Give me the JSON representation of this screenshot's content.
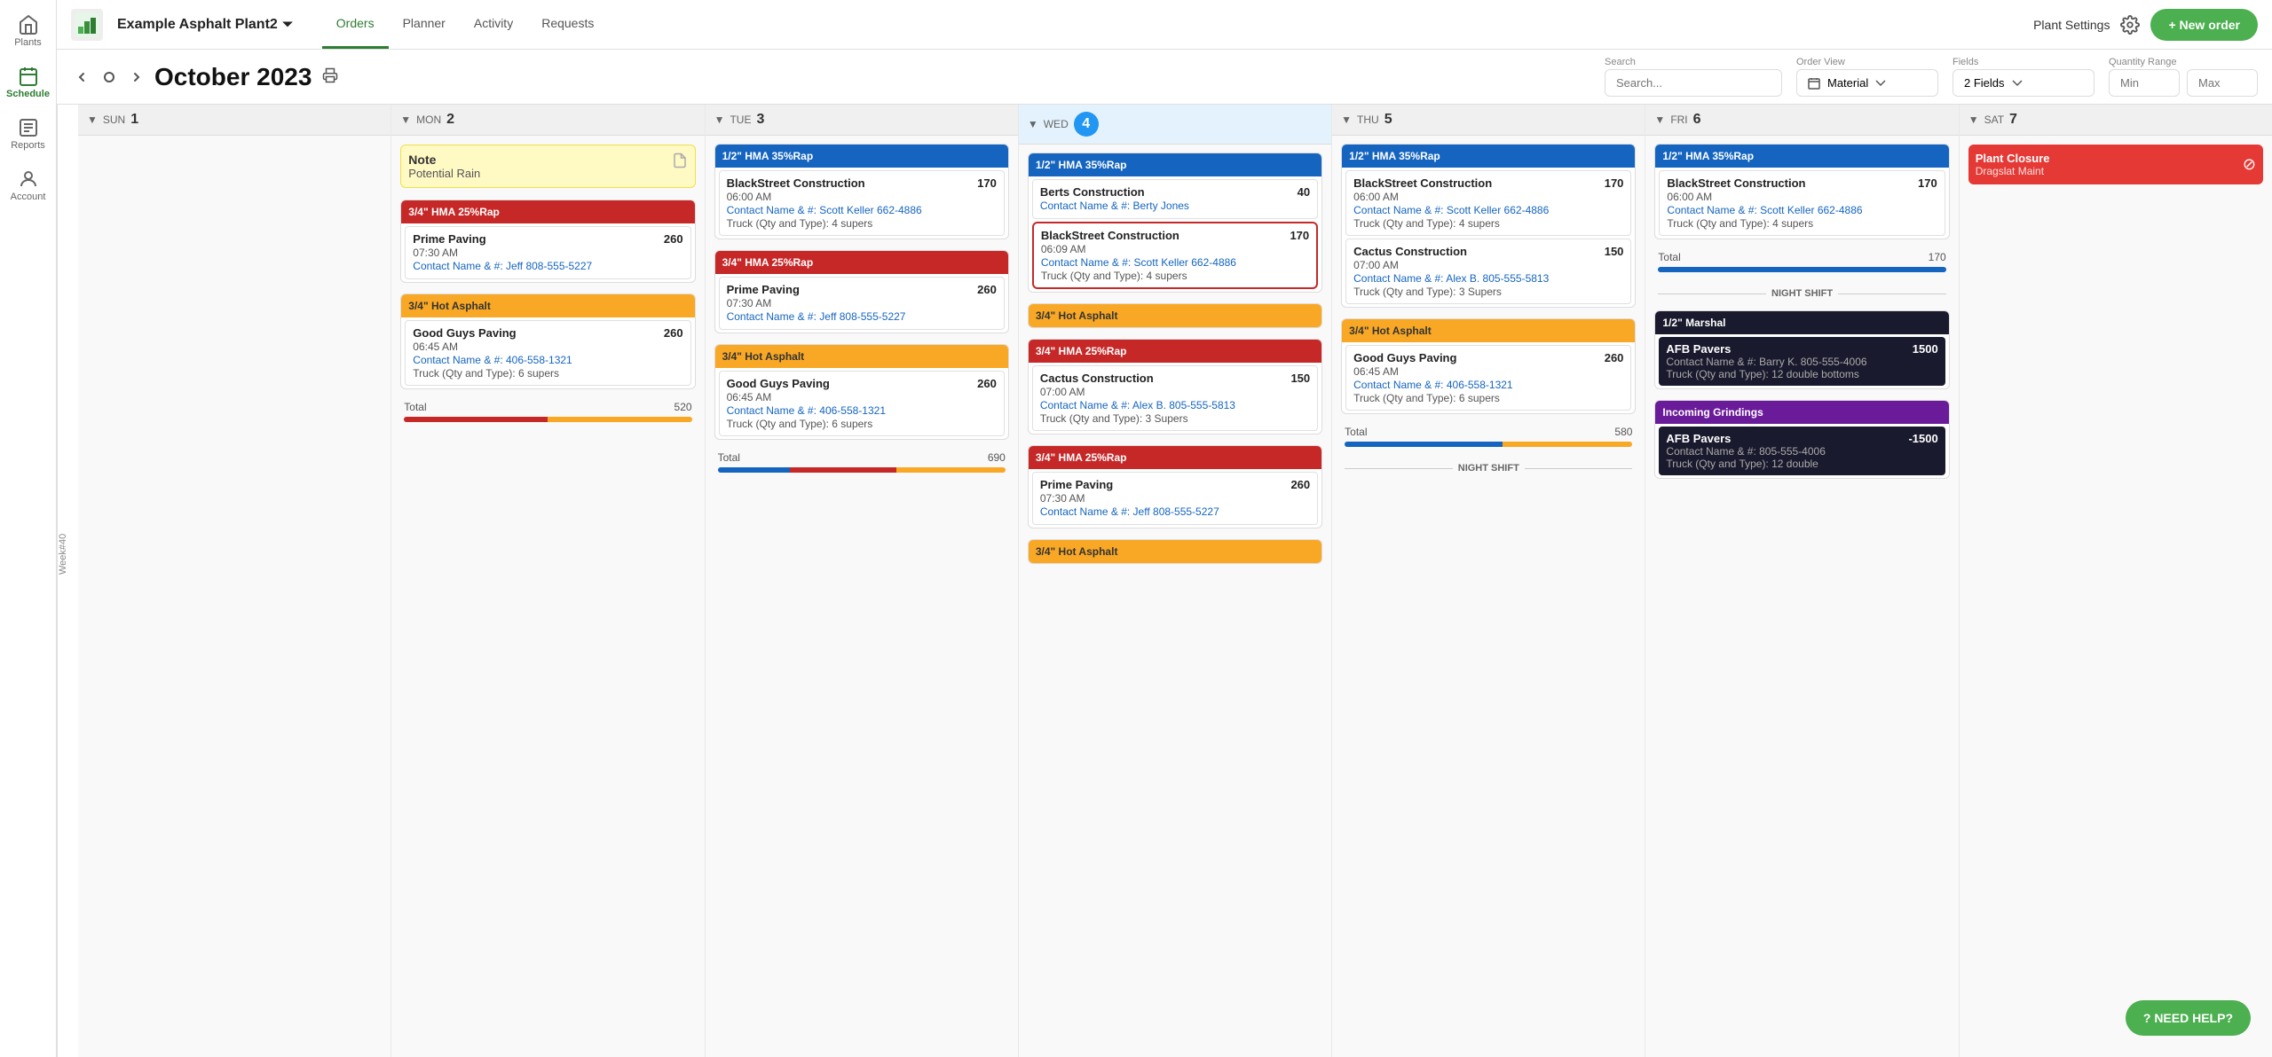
{
  "app": {
    "plant_name": "Example Asphalt Plant2",
    "settings_label": "Plant Settings",
    "new_order_label": "+ New order",
    "need_help_label": "? NEED HELP?"
  },
  "nav": {
    "tabs": [
      "Orders",
      "Planner",
      "Activity",
      "Requests"
    ],
    "active": "Orders"
  },
  "sidebar": {
    "items": [
      {
        "id": "plants",
        "label": "Plants",
        "icon": "home"
      },
      {
        "id": "schedule",
        "label": "Schedule",
        "icon": "calendar",
        "active": true
      },
      {
        "id": "reports",
        "label": "Reports",
        "icon": "reports"
      },
      {
        "id": "account",
        "label": "Account",
        "icon": "user"
      }
    ]
  },
  "toolbar": {
    "month": "October 2023",
    "week_label": "Week#40",
    "search_placeholder": "Search...",
    "search_label": "Search",
    "order_view_label": "Order View",
    "order_view_value": "Material",
    "fields_label": "Fields",
    "fields_value": "2 Fields",
    "qty_range_label": "Quantity Range",
    "qty_min_placeholder": "Min",
    "qty_max_placeholder": "Max"
  },
  "days": [
    {
      "name": "SUN",
      "num": "1",
      "content": []
    },
    {
      "name": "MON",
      "num": "2",
      "note": {
        "title": "Note",
        "body": "Potential Rain"
      },
      "sections": [
        {
          "material": "3/4\" HMA 25%Rap",
          "color": "hma-red",
          "orders": [
            {
              "company": "Prime Paving",
              "qty": "260",
              "time": "07:30 AM",
              "contact": "Contact Name & #: Jeff 808-555-5227",
              "truck": ""
            }
          ]
        },
        {
          "material": "3/4\" Hot Asphalt",
          "color": "asphalt-yellow",
          "orders": [
            {
              "company": "Good Guys Paving",
              "qty": "260",
              "time": "06:45 AM",
              "contact": "Contact Name & #: 406-558-1321",
              "truck": "Truck (Qty and Type): 6 supers"
            }
          ]
        }
      ],
      "total": {
        "label": "Total",
        "value": "520"
      },
      "total_bars": [
        {
          "pct": 50,
          "color": "progress-red"
        },
        {
          "pct": 50,
          "color": "progress-yellow"
        }
      ]
    },
    {
      "name": "TUE",
      "num": "3",
      "sections": [
        {
          "material": "1/2\" HMA 35%Rap",
          "color": "hma-blue",
          "orders": [
            {
              "company": "BlackStreet Construction",
              "qty": "170",
              "time": "06:00 AM",
              "contact": "Contact Name & #: Scott Keller 662-4886",
              "truck": "Truck (Qty and Type): 4 supers"
            }
          ]
        },
        {
          "material": "3/4\" HMA 25%Rap",
          "color": "hma-red",
          "orders": [
            {
              "company": "Prime Paving",
              "qty": "260",
              "time": "07:30 AM",
              "contact": "Contact Name & #: Jeff 808-555-5227",
              "truck": ""
            }
          ]
        },
        {
          "material": "3/4\" Hot Asphalt",
          "color": "asphalt-yellow",
          "orders": [
            {
              "company": "Good Guys Paving",
              "qty": "260",
              "time": "06:45 AM",
              "contact": "Contact Name & #: 406-558-1321",
              "truck": "Truck (Qty and Type): 6 supers"
            }
          ]
        }
      ],
      "total": {
        "label": "Total",
        "value": "690"
      },
      "total_bars": [
        {
          "pct": 25,
          "color": "progress-blue"
        },
        {
          "pct": 37,
          "color": "progress-red"
        },
        {
          "pct": 38,
          "color": "progress-yellow"
        }
      ]
    },
    {
      "name": "WED",
      "num": "4",
      "sections": [
        {
          "material": "1/2\" HMA 35%Rap",
          "color": "hma-blue",
          "orders": [
            {
              "company": "Berts Construction",
              "qty": "40",
              "time": "",
              "contact": "Contact Name & #: Berty Jones",
              "truck": "",
              "highlighted": true
            },
            {
              "company": "BlackStreet Construction",
              "qty": "170",
              "time": "06:09 AM",
              "contact": "Contact Name & #: Scott Keller 662-4886",
              "truck": "Truck (Qty and Type): 4 supers",
              "highlighted": true
            }
          ]
        },
        {
          "material": "3/4\" HMA 25%Rap",
          "color": "hma-red",
          "orders": [
            {
              "company": "Cactus Construction",
              "qty": "150",
              "time": "07:00 AM",
              "contact": "Contact Name & #: Alex B. 805-555-5813",
              "truck": "Truck (Qty and Type): 3 Supers"
            }
          ]
        },
        {
          "material": "3/4\" Hot Asphalt",
          "color": "asphalt-yellow",
          "orders": []
        },
        {
          "material": "3/4\" HMA 25%Rap",
          "color": "hma-red",
          "sub": true,
          "orders": [
            {
              "company": "Prime Paving",
              "qty": "260",
              "time": "07:30 AM",
              "contact": "Contact Name & #: Jeff 808-555-5227",
              "truck": ""
            }
          ]
        },
        {
          "material": "3/4\" Hot Asphalt",
          "color": "asphalt-yellow",
          "sub": true,
          "orders": []
        }
      ],
      "total": null
    },
    {
      "name": "THU",
      "num": "5",
      "sections": [
        {
          "material": "1/2\" HMA 35%Rap",
          "color": "hma-blue",
          "orders": [
            {
              "company": "BlackStreet Construction",
              "qty": "170",
              "time": "06:00 AM",
              "contact": "Contact Name & #: Scott Keller 662-4886",
              "truck": "Truck (Qty and Type): 4 supers"
            },
            {
              "company": "Cactus Construction",
              "qty": "150",
              "time": "07:00 AM",
              "contact": "Contact Name & #: Alex B. 805-555-5813",
              "truck": "Truck (Qty and Type): 3 Supers"
            }
          ]
        },
        {
          "material": "3/4\" Hot Asphalt",
          "color": "asphalt-yellow",
          "orders": [
            {
              "company": "Good Guys Paving",
              "qty": "260",
              "time": "06:45 AM",
              "contact": "Contact Name & #: 406-558-1321",
              "truck": "Truck (Qty and Type): 6 supers"
            }
          ]
        }
      ],
      "total": {
        "label": "Total",
        "value": "580"
      },
      "total_bars": [
        {
          "pct": 55,
          "color": "progress-blue"
        },
        {
          "pct": 45,
          "color": "progress-yellow"
        }
      ],
      "night_shift": true
    },
    {
      "name": "FRI",
      "num": "6",
      "sections": [
        {
          "material": "1/2\" HMA 35%Rap",
          "color": "hma-blue",
          "orders": [
            {
              "company": "BlackStreet Construction",
              "qty": "170",
              "time": "06:00 AM",
              "contact": "Contact Name & #: Scott Keller 662-4886",
              "truck": "Truck (Qty and Type): 4 supers"
            }
          ]
        }
      ],
      "total": {
        "label": "Total",
        "value": "170"
      },
      "total_bars": [
        {
          "pct": 100,
          "color": "progress-blue"
        }
      ],
      "night_shift": true,
      "night_sections": [
        {
          "material": "1/2\" Marshal",
          "color": "marshal-dark",
          "orders": [
            {
              "company": "AFB Pavers",
              "qty": "1500",
              "time": "",
              "contact": "Contact Name & #: Barry K. 805-555-4006",
              "truck": "Truck (Qty and Type): 12 double bottoms",
              "dark": true
            }
          ]
        },
        {
          "material": "Incoming Grindings",
          "color": "grindings-purple",
          "orders": [
            {
              "company": "AFB Pavers",
              "qty": "-1500",
              "time": "",
              "contact": "Contact Name & #: 805-555-4006",
              "truck": "Truck (Qty and Type): 12 double",
              "dark": true
            }
          ]
        }
      ]
    },
    {
      "name": "SAT",
      "num": "7",
      "plant_closure": {
        "title": "Plant Closure",
        "sub": "Dragslat Maint"
      }
    }
  ]
}
